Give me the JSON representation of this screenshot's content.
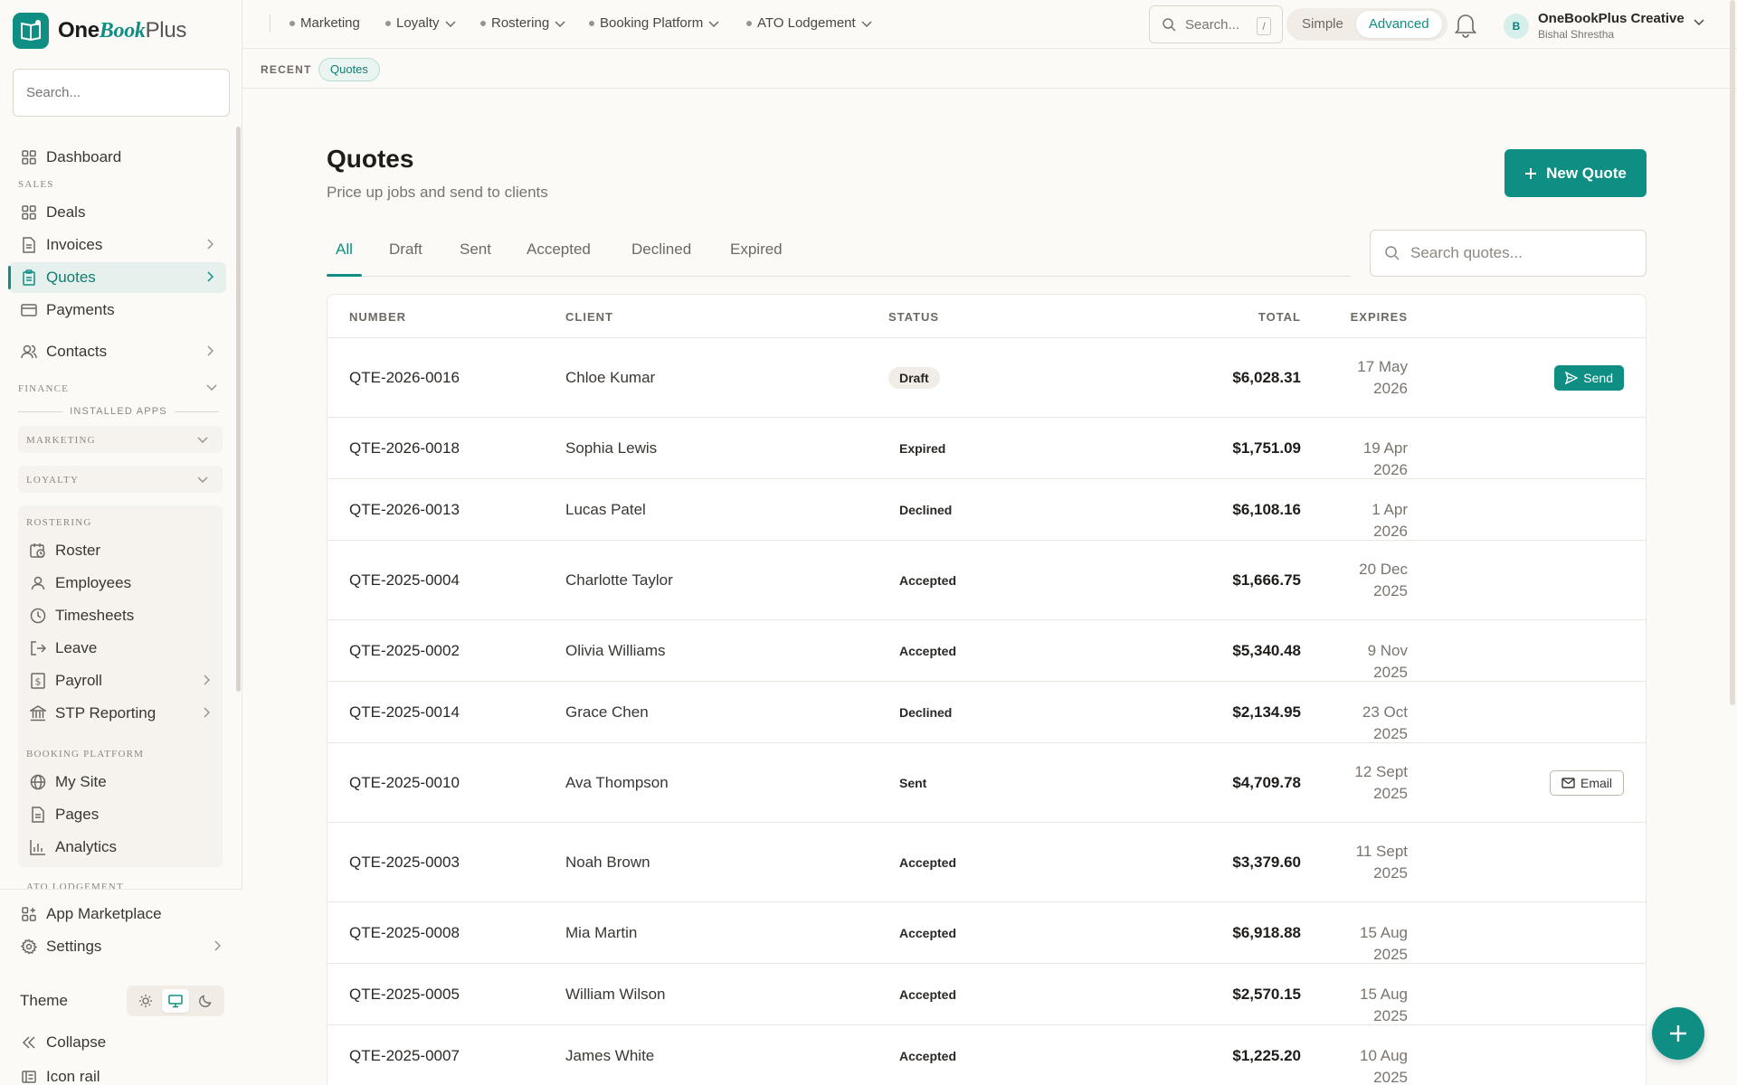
{
  "brand": {
    "one": "One",
    "book": "Book",
    "plus": "Plus"
  },
  "sidebar": {
    "search_placeholder": "Search...",
    "dashboard": "Dashboard",
    "sales_label": "SALES",
    "deals": "Deals",
    "invoices": "Invoices",
    "quotes": "Quotes",
    "payments": "Payments",
    "contacts": "Contacts",
    "finance_label": "FINANCE",
    "installed_apps": "INSTALLED APPS",
    "marketing": "MARKETING",
    "loyalty": "LOYALTY",
    "rostering": "ROSTERING",
    "roster": "Roster",
    "employees": "Employees",
    "timesheets": "Timesheets",
    "leave": "Leave",
    "payroll": "Payroll",
    "stp": "STP Reporting",
    "booking": "BOOKING PLATFORM",
    "mysite": "My Site",
    "pages": "Pages",
    "analytics": "Analytics",
    "ato": "ATO LODGEMENT",
    "marketplace": "App Marketplace",
    "settings": "Settings",
    "theme": "Theme",
    "collapse": "Collapse",
    "icon_rail": "Icon rail"
  },
  "topbar": {
    "apps": [
      "Marketing",
      "Loyalty",
      "Rostering",
      "Booking Platform",
      "ATO Lodgement"
    ],
    "search_placeholder": "Search...",
    "search_kbd": "/",
    "mode_simple": "Simple",
    "mode_advanced": "Advanced",
    "avatar_initial": "B",
    "account_name": "OneBookPlus Creative",
    "account_user": "Bishal Shrestha"
  },
  "recent": {
    "label": "RECENT",
    "chip": "Quotes"
  },
  "page": {
    "title": "Quotes",
    "subtitle": "Price up jobs and send to clients",
    "new_button": "New Quote",
    "tabs": [
      "All",
      "Draft",
      "Sent",
      "Accepted",
      "Declined",
      "Expired"
    ],
    "search_placeholder": "Search quotes..."
  },
  "table": {
    "headers": {
      "number": "NUMBER",
      "client": "CLIENT",
      "status": "STATUS",
      "total": "TOTAL",
      "expires": "EXPIRES"
    },
    "rows": [
      {
        "number": "QTE-2026-0016",
        "client": "Chloe Kumar",
        "status": "Draft",
        "total": "$6,028.31",
        "expires": "17 May 2026",
        "action": "Send"
      },
      {
        "number": "QTE-2026-0018",
        "client": "Sophia Lewis",
        "status": "Expired",
        "total": "$1,751.09",
        "expires": "19 Apr 2026",
        "action": ""
      },
      {
        "number": "QTE-2026-0013",
        "client": "Lucas Patel",
        "status": "Declined",
        "total": "$6,108.16",
        "expires": "1 Apr 2026",
        "action": ""
      },
      {
        "number": "QTE-2025-0004",
        "client": "Charlotte Taylor",
        "status": "Accepted",
        "total": "$1,666.75",
        "expires": "20 Dec 2025",
        "action": ""
      },
      {
        "number": "QTE-2025-0002",
        "client": "Olivia Williams",
        "status": "Accepted",
        "total": "$5,340.48",
        "expires": "9 Nov 2025",
        "action": ""
      },
      {
        "number": "QTE-2025-0014",
        "client": "Grace Chen",
        "status": "Declined",
        "total": "$2,134.95",
        "expires": "23 Oct 2025",
        "action": ""
      },
      {
        "number": "QTE-2025-0010",
        "client": "Ava Thompson",
        "status": "Sent",
        "total": "$4,709.78",
        "expires": "12 Sept 2025",
        "action": "Email"
      },
      {
        "number": "QTE-2025-0003",
        "client": "Noah Brown",
        "status": "Accepted",
        "total": "$3,379.60",
        "expires": "11 Sept 2025",
        "action": ""
      },
      {
        "number": "QTE-2025-0008",
        "client": "Mia Martin",
        "status": "Accepted",
        "total": "$6,918.88",
        "expires": "15 Aug 2025",
        "action": ""
      },
      {
        "number": "QTE-2025-0005",
        "client": "William Wilson",
        "status": "Accepted",
        "total": "$2,570.15",
        "expires": "15 Aug 2025",
        "action": ""
      },
      {
        "number": "QTE-2025-0007",
        "client": "James White",
        "status": "Accepted",
        "total": "$1,225.20",
        "expires": "10 Aug 2025",
        "action": ""
      }
    ]
  },
  "colors": {
    "accent": "#0f8f83",
    "background": "#fcfaf7"
  }
}
